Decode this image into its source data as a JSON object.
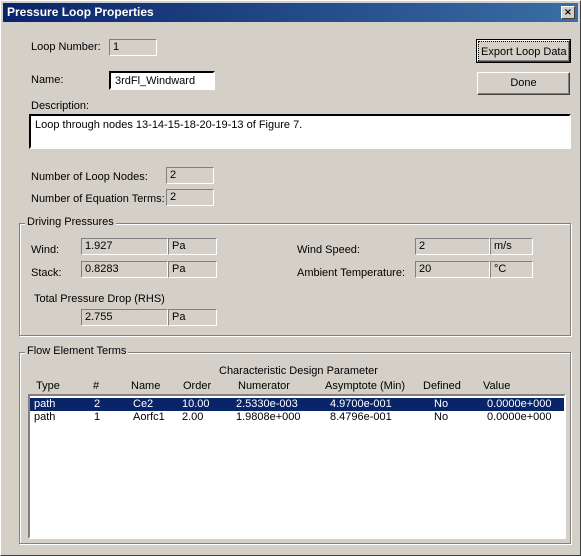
{
  "window": {
    "title": "Pressure Loop Properties",
    "close_glyph": "×"
  },
  "buttons": {
    "export": "Export Loop Data",
    "done": "Done"
  },
  "loop": {
    "number_label": "Loop Number:",
    "number_value": "1",
    "name_label": "Name:",
    "name_value": "3rdFl_Windward",
    "description_label": "Description:",
    "description_value": "Loop through nodes 13-14-15-18-20-19-13 of Figure 7.",
    "nodes_label": "Number of Loop Nodes:",
    "nodes_value": "2",
    "terms_label": "Number of Equation Terms:",
    "terms_value": "2"
  },
  "driving": {
    "group_title": "Driving Pressures",
    "wind_label": "Wind:",
    "wind_value": "1.927",
    "wind_unit": "Pa",
    "stack_label": "Stack:",
    "stack_value": "0.8283",
    "stack_unit": "Pa",
    "windspeed_label": "Wind Speed:",
    "windspeed_value": "2",
    "windspeed_unit": "m/s",
    "ambient_label": "Ambient Temperature:",
    "ambient_value": "20",
    "ambient_unit": "°C",
    "total_label": "Total Pressure Drop (RHS)",
    "total_value": "2.755",
    "total_unit": "Pa"
  },
  "flow": {
    "group_title": "Flow Element Terms",
    "super_header": "Characteristic Design Parameter",
    "columns": [
      "Type",
      "#",
      "Name",
      "Order",
      "Numerator",
      "Asymptote (Min)",
      "Defined",
      "Value"
    ],
    "rows": [
      [
        "path",
        "2",
        "Ce2",
        "10.00",
        "2.5330e-003",
        "4.9700e-001",
        "No",
        "0.0000e+000"
      ],
      [
        "path",
        "1",
        "Aorfc1",
        "2.00",
        "1.9808e+000",
        "8.4796e-001",
        "No",
        "0.0000e+000"
      ]
    ],
    "selected_row": 0
  }
}
